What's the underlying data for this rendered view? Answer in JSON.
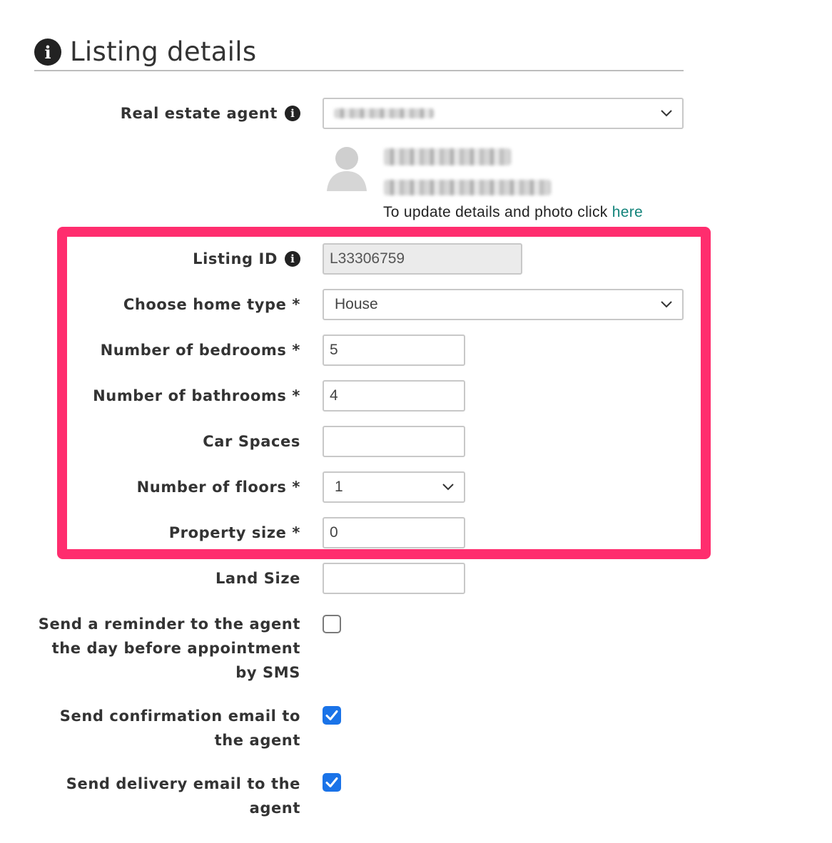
{
  "section": {
    "title": "Listing details",
    "icon": "info-circle-icon"
  },
  "agent": {
    "label": "Real estate agent",
    "update_text": "To update details and photo click ",
    "update_link": "here"
  },
  "fields": {
    "listing_id": {
      "label": "Listing ID",
      "value": "L33306759"
    },
    "home_type": {
      "label": "Choose home type *",
      "value": "House"
    },
    "bedrooms": {
      "label": "Number of bedrooms *",
      "value": "5"
    },
    "bathrooms": {
      "label": "Number of bathrooms *",
      "value": "4"
    },
    "car_spaces": {
      "label": "Car Spaces",
      "value": ""
    },
    "floors": {
      "label": "Number of floors *",
      "value": "1"
    },
    "property_size": {
      "label": "Property size *",
      "value": "0"
    },
    "land_size": {
      "label": "Land Size",
      "value": ""
    }
  },
  "options": {
    "sms_reminder": {
      "label": "Send a reminder to the agent the day before appointment by SMS",
      "checked": false
    },
    "confirmation_email": {
      "label": "Send confirmation email to the agent",
      "checked": true
    },
    "delivery_email": {
      "label": "Send delivery email to the agent",
      "checked": true
    }
  },
  "colors": {
    "accent": "#ff2d6e",
    "link": "#12837a",
    "checkbox": "#1a73e8"
  }
}
